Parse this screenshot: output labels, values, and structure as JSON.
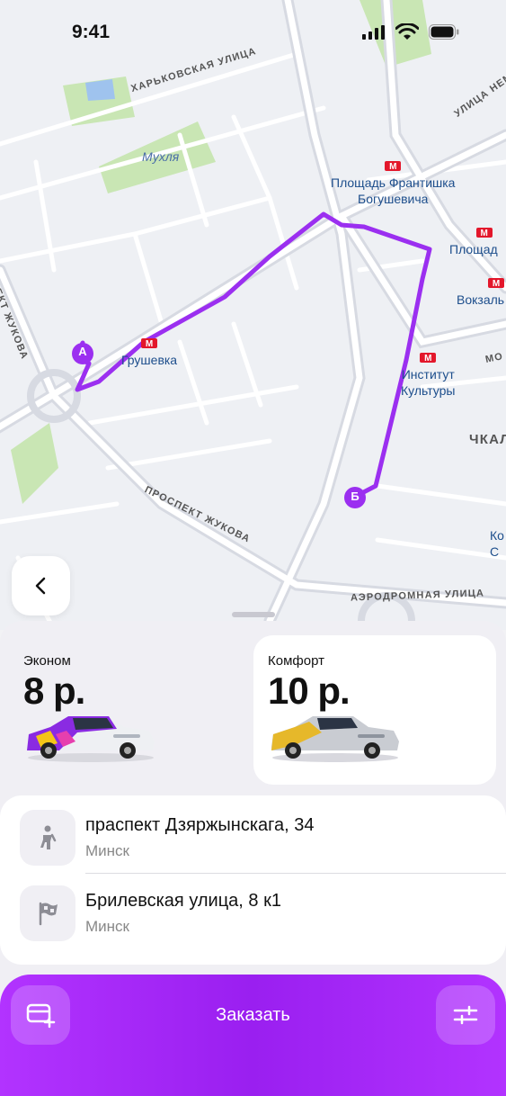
{
  "status": {
    "time": "9:41"
  },
  "map": {
    "streets": {
      "kharkovskaya": "ХАРЬКОВСКАЯ УЛИЦА",
      "ulitsa": "УЛИЦА НЕМ",
      "prospekt_zhukova": "ПРОСПЕКТ ЖУКОВА",
      "prospekt_zhukova_vert": "ПЕКТ ЖУКОВА",
      "aerodromnaya": "АЭРОДРОМНАЯ УЛИЦА",
      "chkala": "ЧКАЛ",
      "mo": "МО"
    },
    "water": "Мухля",
    "metro": {
      "frantishka": "Площадь Франтишка\nБогушевича",
      "grushevka": "Грушевка",
      "institut": "Институт\nКультуры",
      "ploshchad": "Площад",
      "vokzal": "Вокзаль",
      "ko": "Ко\nС"
    },
    "point_a": "А",
    "point_b": "Б",
    "route_color": "#9b2ff0"
  },
  "tariffs": [
    {
      "name": "Эконом",
      "price": "8 р."
    },
    {
      "name": "Комфорт",
      "price": "10 р."
    }
  ],
  "route": {
    "from": {
      "address": "праспект Дзяржынскага, 34",
      "city": "Минск"
    },
    "to": {
      "address": "Брилевская улица, 8 к1",
      "city": "Минск"
    }
  },
  "order": {
    "label": "Заказать",
    "accent": "#a52cf7"
  },
  "icons": {
    "back": "chevron-left-icon",
    "from": "pedestrian-icon",
    "to": "finish-flag-icon",
    "pay": "card-add-icon",
    "filters": "sliders-icon"
  }
}
